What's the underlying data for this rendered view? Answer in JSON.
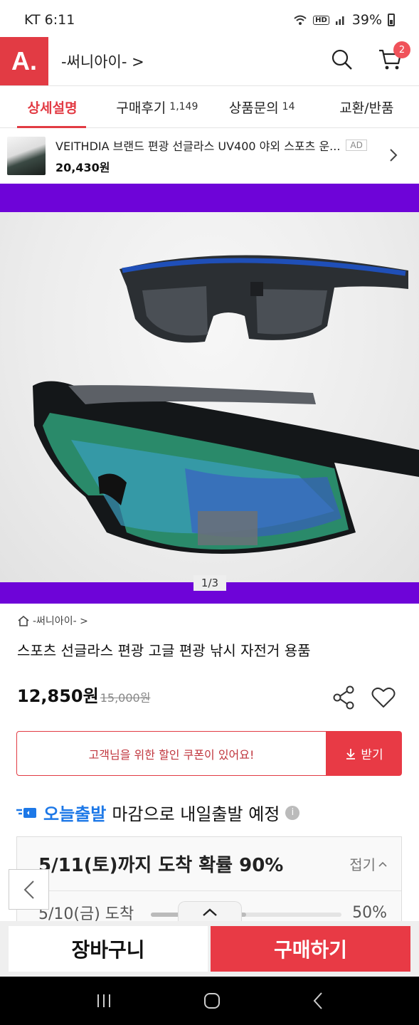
{
  "status_bar": {
    "carrier_time": "KT 6:11",
    "battery": "39%",
    "hd": "HD"
  },
  "header": {
    "logo": "A.",
    "shop_name": "-써니아이- >",
    "cart_count": "2"
  },
  "tabs": [
    {
      "label": "상세설명",
      "count": ""
    },
    {
      "label": "구매후기",
      "count": "1,149"
    },
    {
      "label": "상품문의",
      "count": "14"
    },
    {
      "label": "교환/반품",
      "count": ""
    }
  ],
  "ad": {
    "title": "VEITHDIA 브랜드 편광 선글라스 UV400 야외 스포츠 운...",
    "badge": "AD",
    "price": "20,430원"
  },
  "gallery": {
    "pager": "1/3"
  },
  "product": {
    "store": "-써니아이- >",
    "title": "스포츠 선글라스 편광 고글 편광 낚시 자전거 용품",
    "price": "12,850원",
    "original_price": "15,000원"
  },
  "coupon": {
    "text": "고객님을 위한 할인 쿠폰이 있어요!",
    "button": "받기"
  },
  "shipping": {
    "brand": "오늘출발",
    "text": "마감으로 내일출발 예정",
    "info": "i"
  },
  "delivery": {
    "headline": "5/11(토)까지 도착 확률 90%",
    "collapse_label": "접기",
    "rows": [
      {
        "date": "5/10(금) 도착",
        "prob": "50%",
        "fraction": 0.5
      }
    ]
  },
  "actions": {
    "cart": "장바구니",
    "buy": "구매하기"
  },
  "colors": {
    "brand": "#e23b44",
    "accent_blue": "#1d78e7",
    "hero_bg": "#6e04d8"
  }
}
